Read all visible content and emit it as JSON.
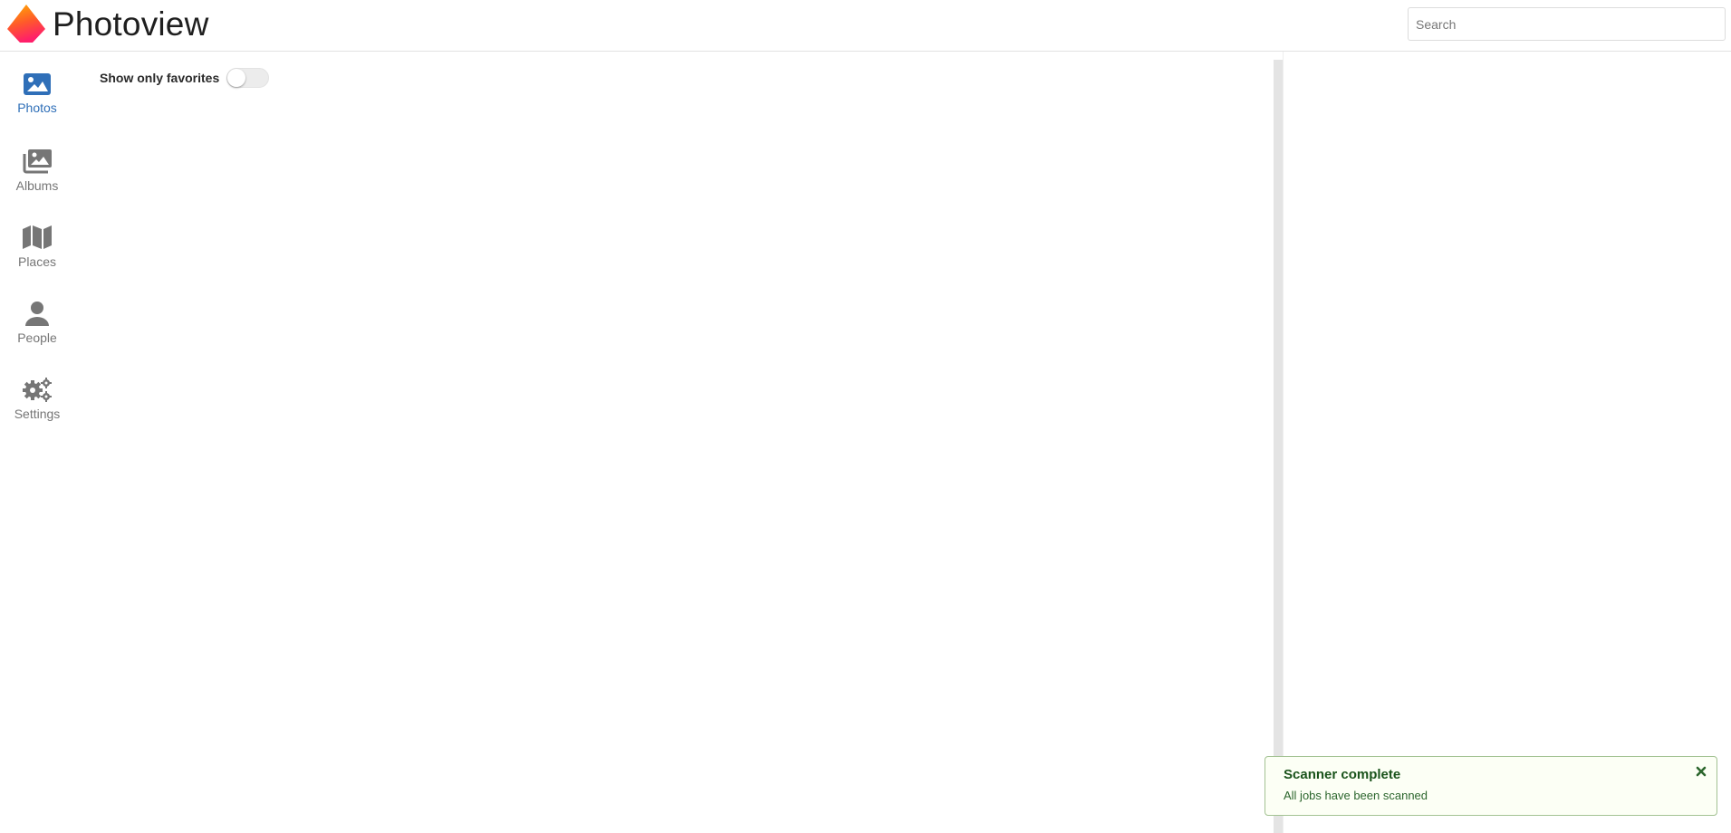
{
  "header": {
    "app_title": "Photoview",
    "search": {
      "placeholder": "Search",
      "value": ""
    }
  },
  "sidebar": {
    "items": [
      {
        "label": "Photos",
        "icon": "image-icon",
        "active": true
      },
      {
        "label": "Albums",
        "icon": "images-icon",
        "active": false
      },
      {
        "label": "Places",
        "icon": "map-icon",
        "active": false
      },
      {
        "label": "People",
        "icon": "user-icon",
        "active": false
      },
      {
        "label": "Settings",
        "icon": "cogs-icon",
        "active": false
      }
    ]
  },
  "main": {
    "favorites_toggle": {
      "label": "Show only favorites",
      "checked": false
    }
  },
  "notification": {
    "title": "Scanner complete",
    "message": "All jobs have been scanned",
    "type": "success"
  },
  "colors": {
    "accent": "#2f6fb8",
    "nav_inactive": "#767676",
    "success_bg": "#fcfff5",
    "success_border": "#a3c293",
    "success_title": "#1a531b"
  }
}
